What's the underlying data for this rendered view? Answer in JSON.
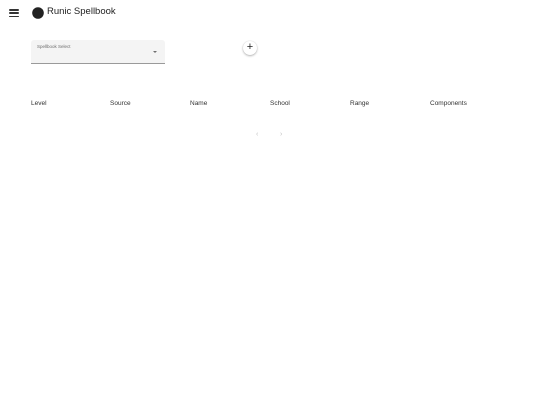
{
  "header": {
    "title": "Runic Spellbook",
    "menu_icon": "menu-icon",
    "logo_icon": "half-moon-logo-icon"
  },
  "spellbook_select": {
    "label": "Spellbook Select",
    "value": ""
  },
  "add_button": {
    "glyph": "+"
  },
  "table": {
    "columns": [
      "Level",
      "Source",
      "Name",
      "School",
      "Range",
      "Components"
    ],
    "rows": []
  },
  "pagination": {
    "prev": "‹",
    "next": "›"
  }
}
